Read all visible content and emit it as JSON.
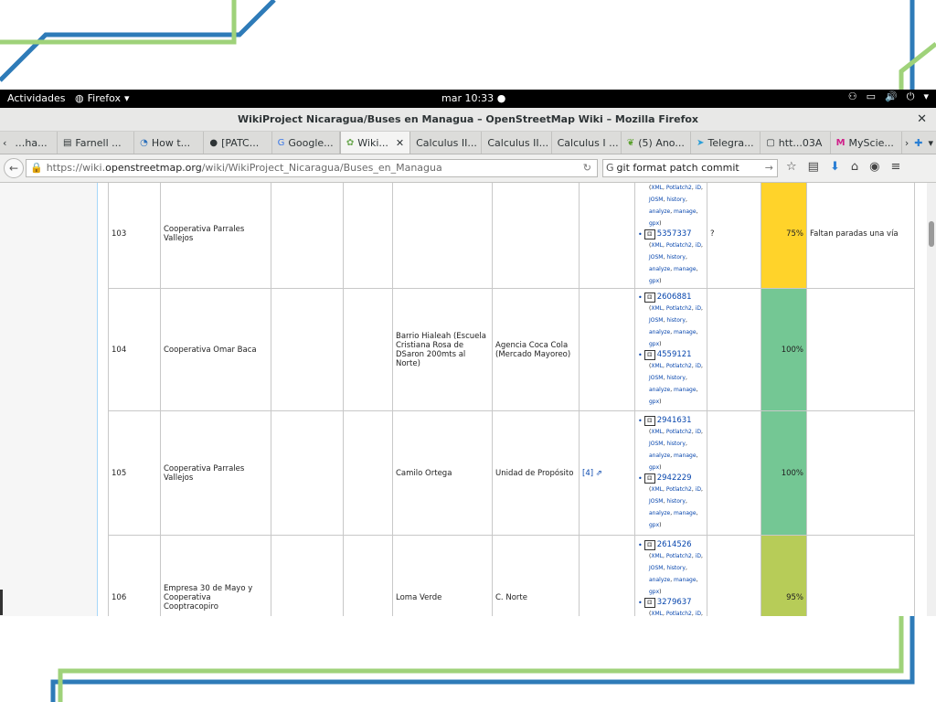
{
  "desktop": {
    "activities": "Actividades",
    "app_menu": "Firefox",
    "clock": "mar 10:33",
    "tray_icons": [
      "accessibility-icon",
      "screen-icon",
      "volume-icon",
      "power-icon"
    ]
  },
  "window": {
    "title": "WikiProject Nicaragua/Buses en Managua – OpenStreetMap Wiki – Mozilla Firefox",
    "close": "✕"
  },
  "tabs": [
    {
      "label": "…ha...",
      "icon": "page-icon"
    },
    {
      "label": "Farnell ...",
      "icon": "farnell-icon"
    },
    {
      "label": "How t...",
      "icon": "ubuntu-icon"
    },
    {
      "label": "[PATC...",
      "icon": "github-icon"
    },
    {
      "label": "Google...",
      "icon": "google-translate-icon"
    },
    {
      "label": "Wiki...",
      "icon": "osm-wiki-icon",
      "active": true
    },
    {
      "label": "Calculus II...",
      "icon": ""
    },
    {
      "label": "Calculus II...",
      "icon": ""
    },
    {
      "label": "Calculus I ...",
      "icon": ""
    },
    {
      "label": "(5) Ano...",
      "icon": "leaf-icon"
    },
    {
      "label": "Telegra...",
      "icon": "telegram-icon"
    },
    {
      "label": "htt...03A",
      "icon": "page-icon"
    },
    {
      "label": "MyScie...",
      "icon": "m-icon"
    }
  ],
  "navbar": {
    "url_prefix": "https://wiki.",
    "url_host": "openstreetmap.org",
    "url_path": "/wiki/WikiProject_Nicaragua/Buses_en_Managua",
    "search_value": "git format patch commit"
  },
  "way_tools": {
    "xml": "XML",
    "potlatch": "Potlatch2",
    "id": "iD",
    "josm": "JOSM",
    "history": "history",
    "analyze": "analyze",
    "manage": "manage",
    "gpx": "gpx"
  },
  "rows": [
    {
      "route": "103",
      "operator": "Cooperativa Parrales Vallejos",
      "from": "",
      "to": "",
      "ref": "",
      "ways": [
        "5357337"
      ],
      "note_mark": "?",
      "percent": "75%",
      "status_color": "#ffd32a",
      "comment": "Faltan paradas una vía"
    },
    {
      "route": "104",
      "operator": "Cooperativa Omar Baca",
      "from": "Barrio Hialeah (Escuela Cristiana Rosa de DSaron 200mts al Norte)",
      "to": "Agencia Coca Cola (Mercado Mayoreo)",
      "ref": "",
      "ways": [
        "2606881",
        "4559121"
      ],
      "note_mark": "",
      "percent": "100%",
      "status_color": "#74c794",
      "comment": ""
    },
    {
      "route": "105",
      "operator": "Cooperativa Parrales Vallejos",
      "from": "Camilo Ortega",
      "to": "Unidad de Propósito",
      "ref": "[4]",
      "ways": [
        "2941631",
        "2942229"
      ],
      "note_mark": "",
      "percent": "100%",
      "status_color": "#74c794",
      "comment": ""
    },
    {
      "route": "106",
      "operator": "Empresa 30 de Mayo y Cooperativa Cooptracopiro",
      "from": "Loma Verde",
      "to": "C. Norte",
      "ref": "",
      "ways": [
        "2614526",
        "3279637"
      ],
      "note_mark": "",
      "percent": "95%",
      "status_color": "#b7cc58",
      "comment": ""
    }
  ]
}
